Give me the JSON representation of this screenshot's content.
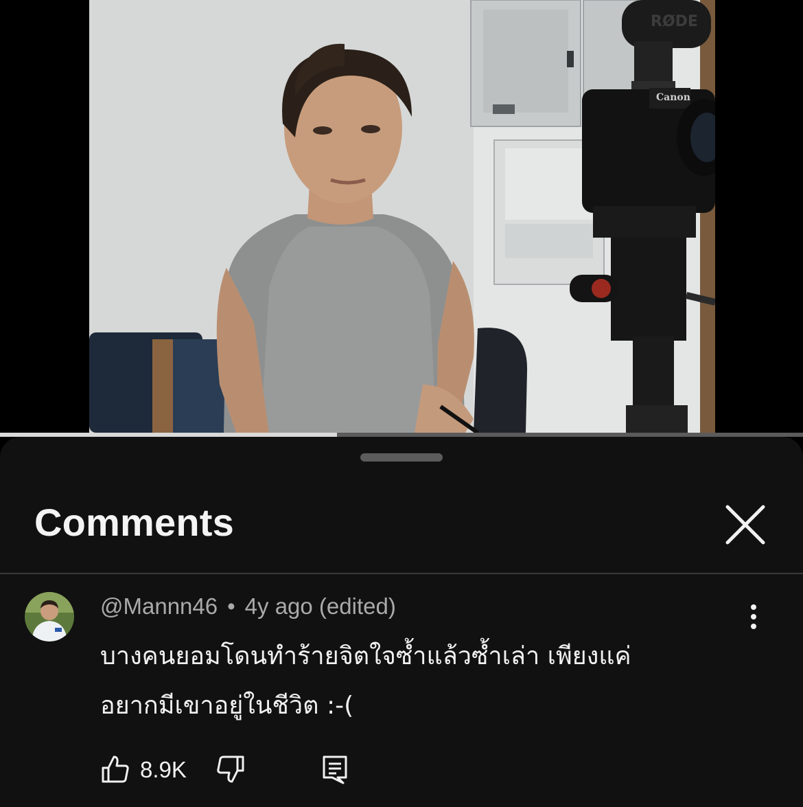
{
  "player": {
    "progress_fraction": 0.42,
    "mic_brand": "RØDE",
    "camera_brand": "Canon"
  },
  "sheet": {
    "title": "Comments"
  },
  "comment": {
    "author": "@Mannn46",
    "separator": "•",
    "age": "4y ago (edited)",
    "text_line1": "บางคนยอมโดนทำร้ายจิตใจซ้ำแล้วซ้ำเล่า เพียงแค่",
    "text_line2": "อยากมีเขาอยู่ในชีวิต :-(",
    "likes": "8.9K"
  },
  "icons": {
    "close": "close-icon",
    "more": "more-vertical-icon",
    "like": "thumbs-up-icon",
    "dislike": "thumbs-down-icon",
    "reply": "reply-icon"
  }
}
